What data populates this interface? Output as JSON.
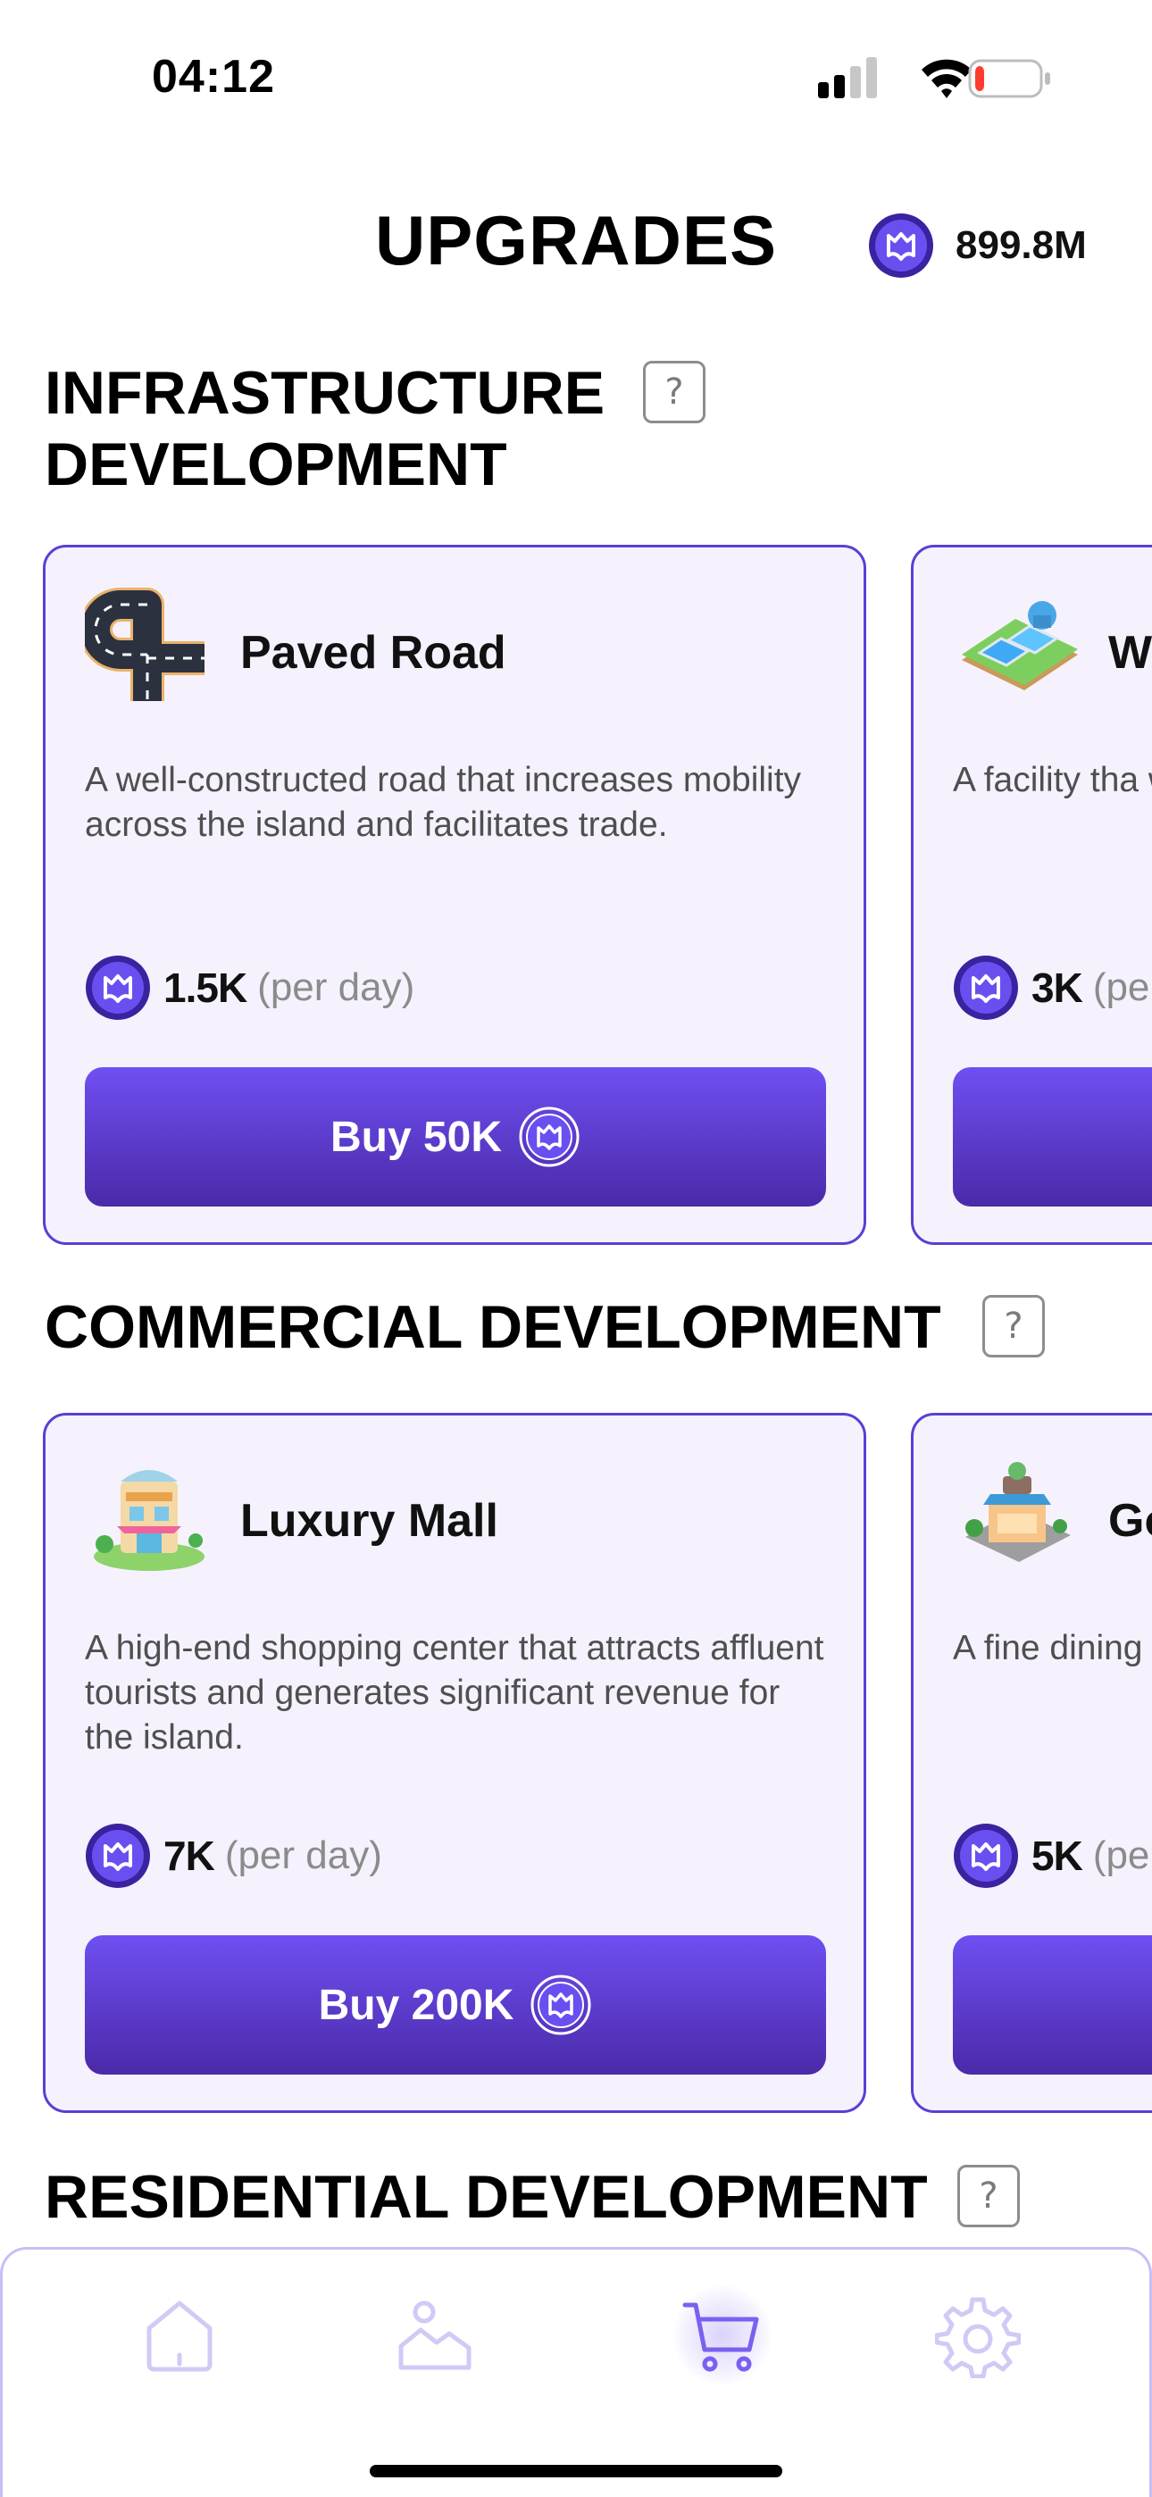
{
  "status_bar": {
    "time": "04:12",
    "battery_level": 0.15,
    "battery_color": "#ff3b30",
    "icons": [
      "signal-icon",
      "wifi-icon",
      "battery-icon"
    ]
  },
  "header": {
    "title": "UPGRADES",
    "balance": "899.8M",
    "coin_icon": "coin-icon"
  },
  "colors": {
    "accent": "#6f4ff2",
    "accent_dark": "#4a2aa8",
    "card_background": "#f5f2fd",
    "card_border": "#5a3fd6"
  },
  "sections": [
    {
      "title_lines": [
        "INFRASTRUCTURE",
        "DEVELOPMENT"
      ],
      "help": "?",
      "cards": [
        {
          "name": "Paved Road",
          "icon": "paved-road-icon",
          "description": "A well-constructed road that increases mobility across the island and facilitates trade.",
          "rate": "1.5K",
          "rate_unit": "(per day)",
          "buy_label": "Buy 50K"
        },
        {
          "name": "W",
          "icon": "water-facility-icon",
          "description": "A facility tha water to the sustainabilit",
          "rate": "3K",
          "rate_unit": "(pe",
          "buy_label": ""
        }
      ]
    },
    {
      "title_lines": [
        "COMMERCIAL DEVELOPMENT"
      ],
      "help": "?",
      "cards": [
        {
          "name": "Luxury Mall",
          "icon": "luxury-mall-icon",
          "description": "A high-end shopping center that attracts affluent tourists and generates significant revenue for the island.",
          "rate": "7K",
          "rate_unit": "(per day)",
          "buy_label": "Buy 200K"
        },
        {
          "name": "Go",
          "icon": "restaurant-icon",
          "description": "A fine dining world-class paying cust",
          "rate": "5K",
          "rate_unit": "(pe",
          "buy_label": ""
        }
      ]
    },
    {
      "title_lines": [
        "RESIDENTIAL DEVELOPMENT"
      ],
      "help": "?",
      "cards": []
    }
  ],
  "bottom_nav": {
    "items": [
      {
        "name": "home",
        "icon": "home-icon",
        "active": false
      },
      {
        "name": "island",
        "icon": "island-icon",
        "active": false
      },
      {
        "name": "shop",
        "icon": "cart-icon",
        "active": true
      },
      {
        "name": "settings",
        "icon": "gear-icon",
        "active": false
      }
    ]
  }
}
